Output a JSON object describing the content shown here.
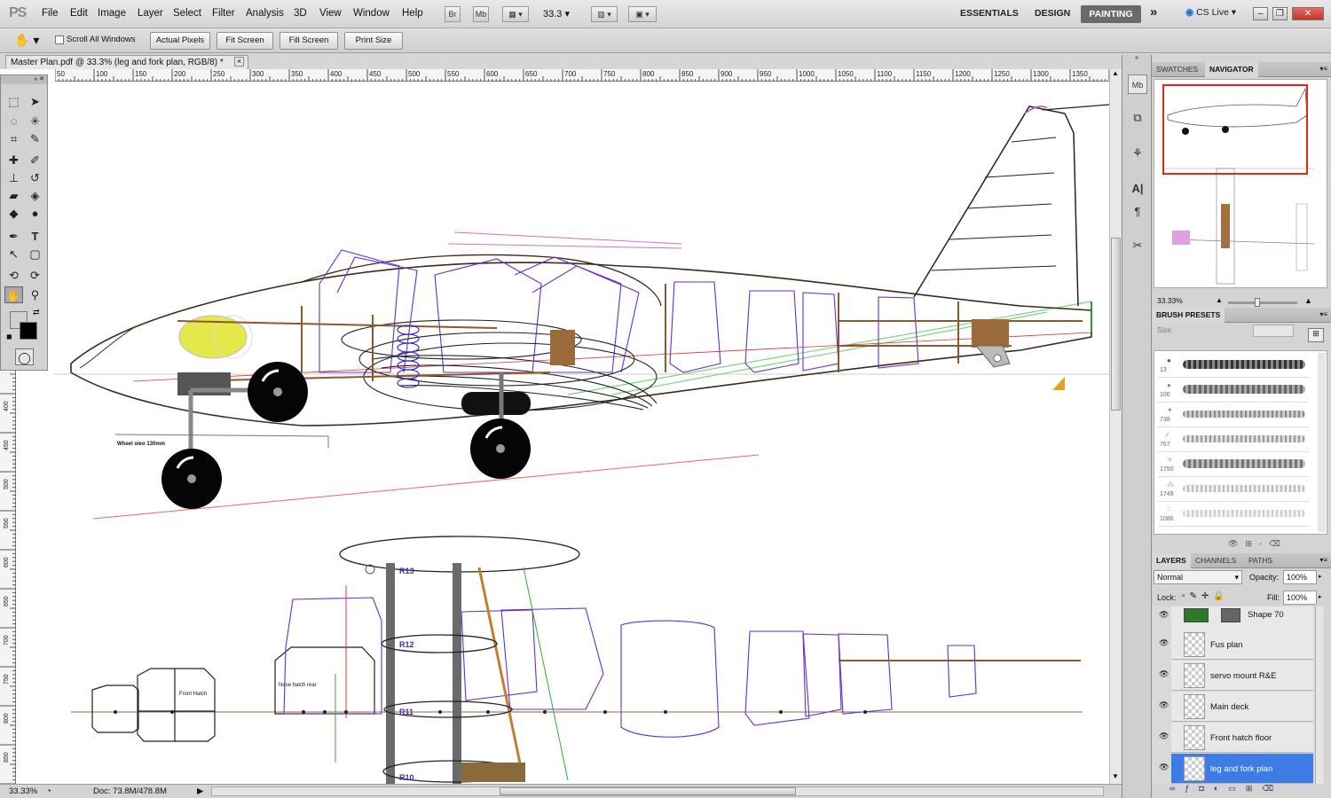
{
  "app": {
    "logo": "PS"
  },
  "menu": [
    "File",
    "Edit",
    "Image",
    "Layer",
    "Select",
    "Filter",
    "Analysis",
    "3D",
    "View",
    "Window",
    "Help"
  ],
  "appbar": {
    "br_label": "Br",
    "mb_label": "Mb",
    "zoom": "33.3"
  },
  "workspaces": {
    "essentials": "ESSENTIALS",
    "design": "DESIGN",
    "painting": "PAINTING",
    "more": "»",
    "cslive": "CS Live"
  },
  "options": {
    "scroll_all": "Scroll All Windows",
    "actual_pixels": "Actual Pixels",
    "fit_screen": "Fit Screen",
    "fill_screen": "Fill Screen",
    "print_size": "Print Size"
  },
  "document": {
    "tab_title": "Master Plan.pdf @ 33.3% (leg and fork plan, RGB/8) *",
    "close": "×"
  },
  "ruler": {
    "h_labels": [
      "50",
      "100",
      "150",
      "200",
      "250",
      "300",
      "350",
      "400",
      "450",
      "500",
      "550",
      "600",
      "650",
      "700",
      "750",
      "800",
      "850",
      "900",
      "950",
      "1000",
      "1050",
      "1100",
      "1150",
      "1200",
      "1250",
      "1300",
      "1350"
    ],
    "v_labels": [
      "400",
      "450",
      "500",
      "550",
      "600",
      "650",
      "700",
      "750",
      "800",
      "850"
    ]
  },
  "drawing": {
    "labels": {
      "wheel_oleo": "Wheel oleo 130mm",
      "front_hatch": "Front Hatch",
      "nose_hatch_rear": "Nose hatch rear",
      "ribs": [
        "R13",
        "R12",
        "R11",
        "R10"
      ]
    }
  },
  "status": {
    "zoom": "33.33%",
    "doc": "Doc: 73.8M/478.8M"
  },
  "panels": {
    "top_tabs": [
      "SWATCHES",
      "NAVIGATOR"
    ],
    "nav_zoom": "33.33%",
    "brush_title": "BRUSH PRESETS",
    "brush_size_label": "Size:",
    "brush_sizes": [
      "13",
      "100",
      "738",
      "767",
      "1750",
      "1749",
      "1086"
    ],
    "layer_tabs": [
      "LAYERS",
      "CHANNELS",
      "PATHS"
    ],
    "blend_mode": "Normal",
    "opacity_label": "Opacity:",
    "opacity": "100%",
    "lock_label": "Lock:",
    "fill_label": "Fill:",
    "fill": "100%",
    "layers": [
      "Shape 70",
      "Fus plan",
      "servo mount R&E",
      "Main deck",
      "Front hatch floor",
      "leg and fork plan"
    ]
  },
  "colors": {
    "accent": "#3d7de3",
    "outline": "#5a3d1e",
    "frame": "#6a2bd1",
    "ruler": "#f4f4f4"
  }
}
